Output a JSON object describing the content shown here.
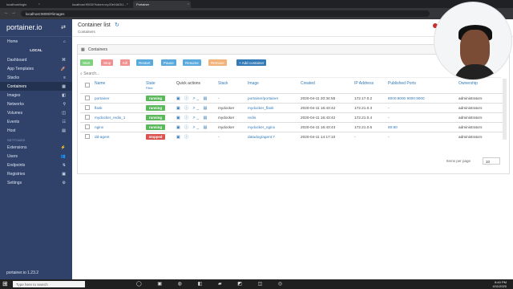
{
  "browser": {
    "tabs": [
      {
        "label": "localhost/login"
      },
      {
        "label": "localhost:9000/?token=eyJ0eXAiOiJ..."
      },
      {
        "label": "Portainer"
      }
    ],
    "address": "localhost:9000/#/images"
  },
  "sidebar": {
    "logo": "portainer.io",
    "endpoint": "LOCAL",
    "items": [
      {
        "label": "Home",
        "icon": "home-icon",
        "glyph": "⌂"
      },
      {
        "label": "Dashboard",
        "icon": "dashboard-icon",
        "glyph": "⌘"
      },
      {
        "label": "App Templates",
        "icon": "rocket-icon",
        "glyph": "🚀"
      },
      {
        "label": "Stacks",
        "icon": "stack-icon",
        "glyph": "≡"
      },
      {
        "label": "Containers",
        "icon": "containers-icon",
        "glyph": "▦"
      },
      {
        "label": "Images",
        "icon": "images-icon",
        "glyph": "◧"
      },
      {
        "label": "Networks",
        "icon": "network-icon",
        "glyph": "⚲"
      },
      {
        "label": "Volumes",
        "icon": "volume-icon",
        "glyph": "◫"
      },
      {
        "label": "Events",
        "icon": "history-icon",
        "glyph": "☷"
      },
      {
        "label": "Host",
        "icon": "host-icon",
        "glyph": "▤"
      }
    ],
    "settings_header": "SETTINGS",
    "settings": [
      {
        "label": "Extensions",
        "icon": "extensions-icon",
        "glyph": "⚡"
      },
      {
        "label": "Users",
        "icon": "users-icon",
        "glyph": "👥"
      },
      {
        "label": "Endpoints",
        "icon": "endpoint-icon",
        "glyph": "⇅"
      },
      {
        "label": "Registries",
        "icon": "registry-icon",
        "glyph": "▣"
      },
      {
        "label": "Settings",
        "icon": "settings-icon",
        "glyph": "⚙"
      }
    ],
    "version": "1.23.2"
  },
  "page": {
    "title": "Container list",
    "breadcrumb": "Containers"
  },
  "containers_panel": {
    "title": "Containers",
    "buttons": [
      {
        "label": "Start",
        "name": "start-button",
        "kind": "green"
      },
      {
        "label": "Stop",
        "name": "stop-button",
        "kind": "red"
      },
      {
        "label": "Kill",
        "name": "kill-button",
        "kind": "red"
      },
      {
        "label": "Restart",
        "name": "restart-button",
        "kind": "blue"
      },
      {
        "label": "Pause",
        "name": "pause-button",
        "kind": "blue"
      },
      {
        "label": "Resume",
        "name": "resume-button",
        "kind": "blue"
      },
      {
        "label": "Remove",
        "name": "remove-button",
        "kind": "orange"
      },
      {
        "label": "+ Add container",
        "name": "add-container-button",
        "kind": "primary"
      }
    ],
    "search_placeholder": "Search...",
    "columns": [
      "Name",
      "State",
      "Quick actions",
      "Stack",
      "Image",
      "Created",
      "IP Address",
      "Published Ports",
      "Ownership"
    ],
    "state_filter": "Filter",
    "rows": [
      {
        "name": "portainer",
        "state": "running",
        "stack": "-",
        "image": "portainer/portainer",
        "created": "2020-04-11 20:34:55",
        "ip": "172.17.0.2",
        "ports": "8000:8000  9000:9000",
        "owner": "administrators"
      },
      {
        "name": "flask",
        "state": "running",
        "stack": "mydocker",
        "image": "mydocker_flask",
        "created": "2020-04-11 16:43:42",
        "ip": "172.21.0.3",
        "ports": "-",
        "owner": "administrators"
      },
      {
        "name": "mydocker_redis_1",
        "state": "running",
        "stack": "mydocker",
        "image": "redis",
        "created": "2020-04-11 16:43:42",
        "ip": "172.21.0.4",
        "ports": "-",
        "owner": "administrators"
      },
      {
        "name": "nginx",
        "state": "running",
        "stack": "mydocker",
        "image": "mydocker_nginx",
        "created": "2020-04-11 16:43:43",
        "ip": "172.21.0.5",
        "ports": "80:80",
        "owner": "administrators"
      },
      {
        "name": "dd-agent",
        "state": "stopped",
        "stack": "-",
        "image": "datadog/agent:7",
        "created": "2020-04-11 14:17:10",
        "ip": "-",
        "ports": "-",
        "owner": "administrators"
      }
    ],
    "items_per_page_label": "Items per page",
    "items_per_page": "10"
  },
  "taskbar": {
    "search_placeholder": "Type here to search",
    "time": "8:40 PM",
    "date": "4/11/2020"
  },
  "status_url": "localhost:9000/#/images",
  "colors": {
    "sidebar": "#30426a",
    "accent": "#337ab7",
    "running": "#5cb85c",
    "stopped": "#d9534f"
  }
}
